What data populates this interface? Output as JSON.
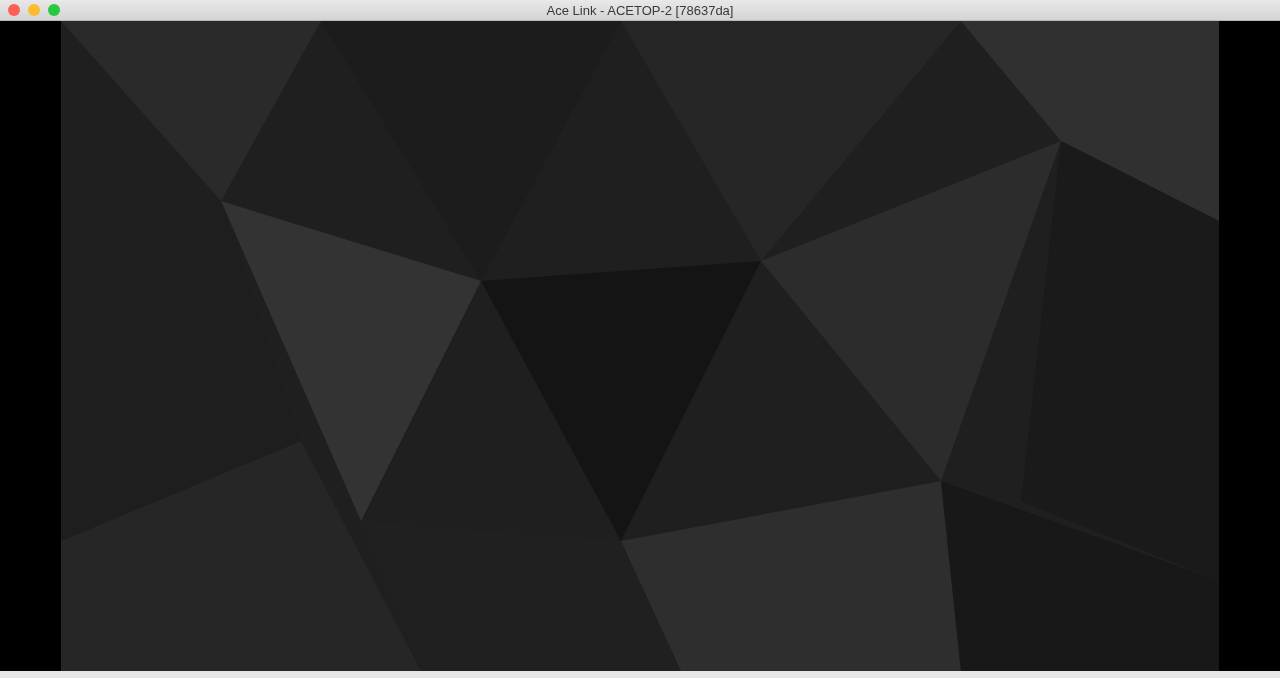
{
  "window": {
    "title": "Ace Link - ACETOP-2 [78637da]"
  }
}
